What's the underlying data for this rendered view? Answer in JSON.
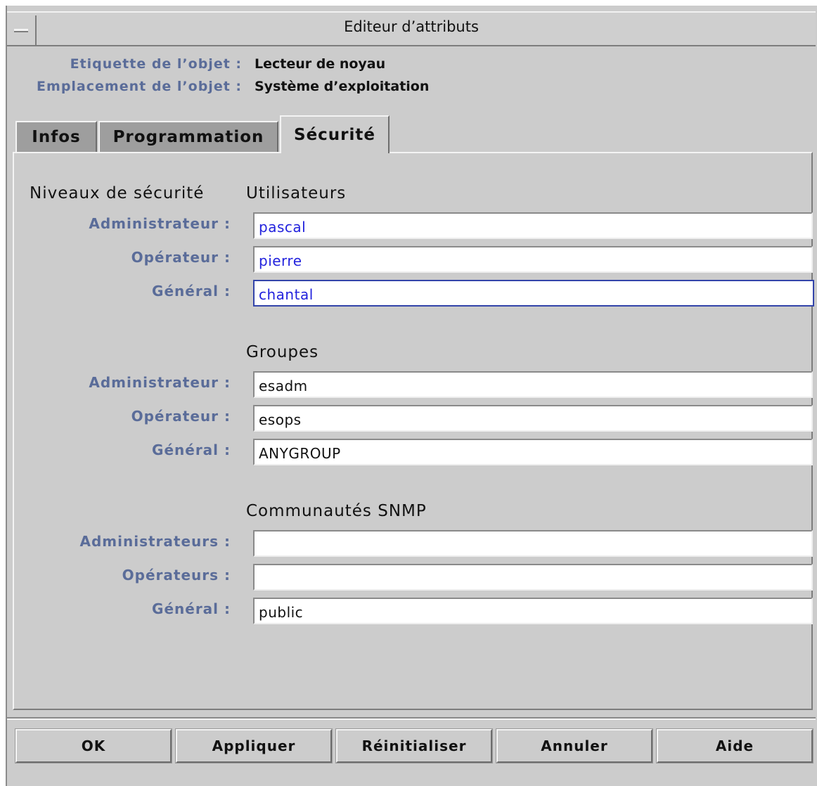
{
  "window": {
    "title": "Editeur d’attributs"
  },
  "object_info": {
    "label_caption": "Etiquette de l’objet :",
    "label_value": "Lecteur de noyau",
    "location_caption": "Emplacement de l’objet :",
    "location_value": "Système d’exploitation"
  },
  "tabs": [
    {
      "label": "Infos",
      "selected": false
    },
    {
      "label": "Programmation",
      "selected": false
    },
    {
      "label": "Sécurité",
      "selected": true
    }
  ],
  "security": {
    "levels_heading": "Niveaux de sécurité",
    "users": {
      "heading": "Utilisateurs",
      "admin_label": "Administrateur :",
      "admin_value": "pascal",
      "operator_label": "Opérateur :",
      "operator_value": "pierre",
      "general_label": "Général :",
      "general_value": "chantal"
    },
    "groups": {
      "heading": "Groupes",
      "admin_label": "Administrateur :",
      "admin_value": "esadm",
      "operator_label": "Opérateur :",
      "operator_value": "esops",
      "general_label": "Général :",
      "general_value": "ANYGROUP"
    },
    "snmp": {
      "heading": "Communautés SNMP",
      "admin_label": "Administrateurs :",
      "admin_value": "",
      "operator_label": "Opérateurs :",
      "operator_value": "",
      "general_label": "Général :",
      "general_value": "public"
    }
  },
  "buttons": {
    "ok": "OK",
    "apply": "Appliquer",
    "reset": "Réinitialiser",
    "cancel": "Annuler",
    "help": "Aide"
  },
  "colors": {
    "window_bg": "#cccccc",
    "label_blue": "#5a6c99",
    "user_value_blue": "#2222dd"
  }
}
